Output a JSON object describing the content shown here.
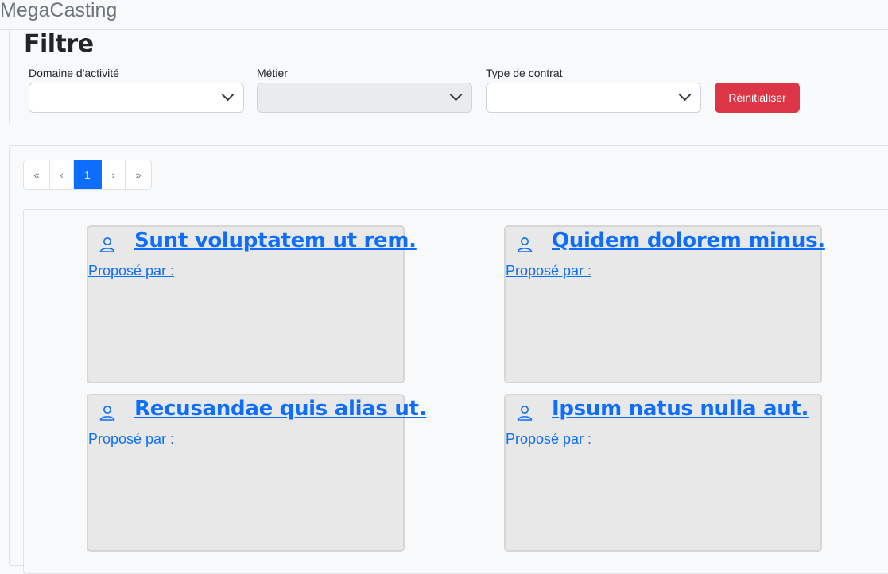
{
  "brand": "MegaCasting",
  "filter": {
    "title": "Filtre",
    "domaine_label": "Domaine d'activité",
    "metier_label": "Métier",
    "contrat_label": "Type de contrat",
    "reset_label": "Réinitialiser"
  },
  "pagination": {
    "first": "«",
    "prev": "‹",
    "current": "1",
    "next": "›",
    "last": "»"
  },
  "offers": [
    {
      "title": "Sunt voluptatem ut rem.",
      "proposed_by": "Proposé par :"
    },
    {
      "title": "Quidem dolorem minus.",
      "proposed_by": "Proposé par :"
    },
    {
      "title": "Recusandae quis alias ut.",
      "proposed_by": "Proposé par :"
    },
    {
      "title": "Ipsum natus nulla aut.",
      "proposed_by": "Proposé par :"
    }
  ],
  "icons": {
    "card": "user-icon",
    "select": "chevron-down-icon"
  },
  "colors": {
    "primary": "#0d6efd",
    "danger": "#dc3545",
    "card_bg": "#e8e8e8"
  }
}
